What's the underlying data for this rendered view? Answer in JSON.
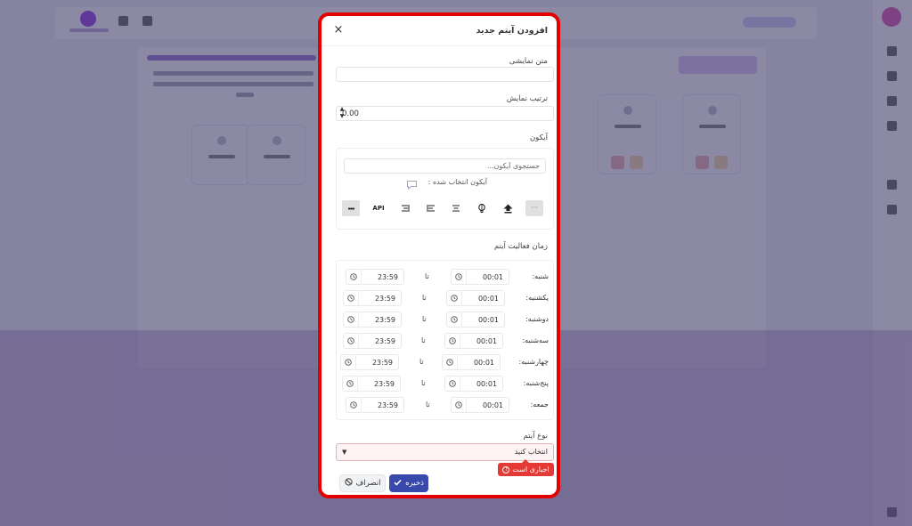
{
  "modal": {
    "title": "افزودن آیتم جدید",
    "close_icon": "×",
    "display_text": {
      "label": "متن نمایشی",
      "value": ""
    },
    "display_order": {
      "label": "ترتیب نمایش",
      "value": "0.00"
    },
    "icon": {
      "label": "آیکون",
      "search_placeholder": "جستجوی آیکون...",
      "selected_label": "آیکون انتخاب شده :",
      "selected_icon": "comment-icon",
      "options": [
        {
          "name": "minus-icon",
          "glyph": "━"
        },
        {
          "name": "api-icon",
          "glyph": "API"
        },
        {
          "name": "align-right-icon",
          "glyph": ""
        },
        {
          "name": "align-left-icon",
          "glyph": ""
        },
        {
          "name": "align-center-icon",
          "glyph": ""
        },
        {
          "name": "balloon-icon",
          "glyph": ""
        },
        {
          "name": "upload-icon",
          "glyph": ""
        },
        {
          "name": "placeholder-icon",
          "glyph": "···"
        }
      ]
    },
    "activity_time": {
      "label": "زمان فعالیت آیتم",
      "separator": "تا",
      "days": [
        {
          "day": "شنبه:",
          "from": "00:01",
          "to": "23:59"
        },
        {
          "day": "یکشنبه:",
          "from": "00:01",
          "to": "23:59"
        },
        {
          "day": "دوشنبه:",
          "from": "00:01",
          "to": "23:59"
        },
        {
          "day": "سه‌شنبه:",
          "from": "00:01",
          "to": "23:59"
        },
        {
          "day": "چهارشنبه:",
          "from": "00:01",
          "to": "23:59"
        },
        {
          "day": "پنج‌شنبه:",
          "from": "00:01",
          "to": "23:59"
        },
        {
          "day": "جمعه:",
          "from": "00:01",
          "to": "23:59"
        }
      ]
    },
    "item_type": {
      "label": "نوع آیتم",
      "placeholder": "انتخاب کنید",
      "error": "اجباری است"
    },
    "buttons": {
      "save": "ذخیره",
      "cancel": "انصراف"
    }
  },
  "colors": {
    "accent": "#3949ab",
    "highlight_border": "#e20000",
    "error": "#e53935"
  }
}
